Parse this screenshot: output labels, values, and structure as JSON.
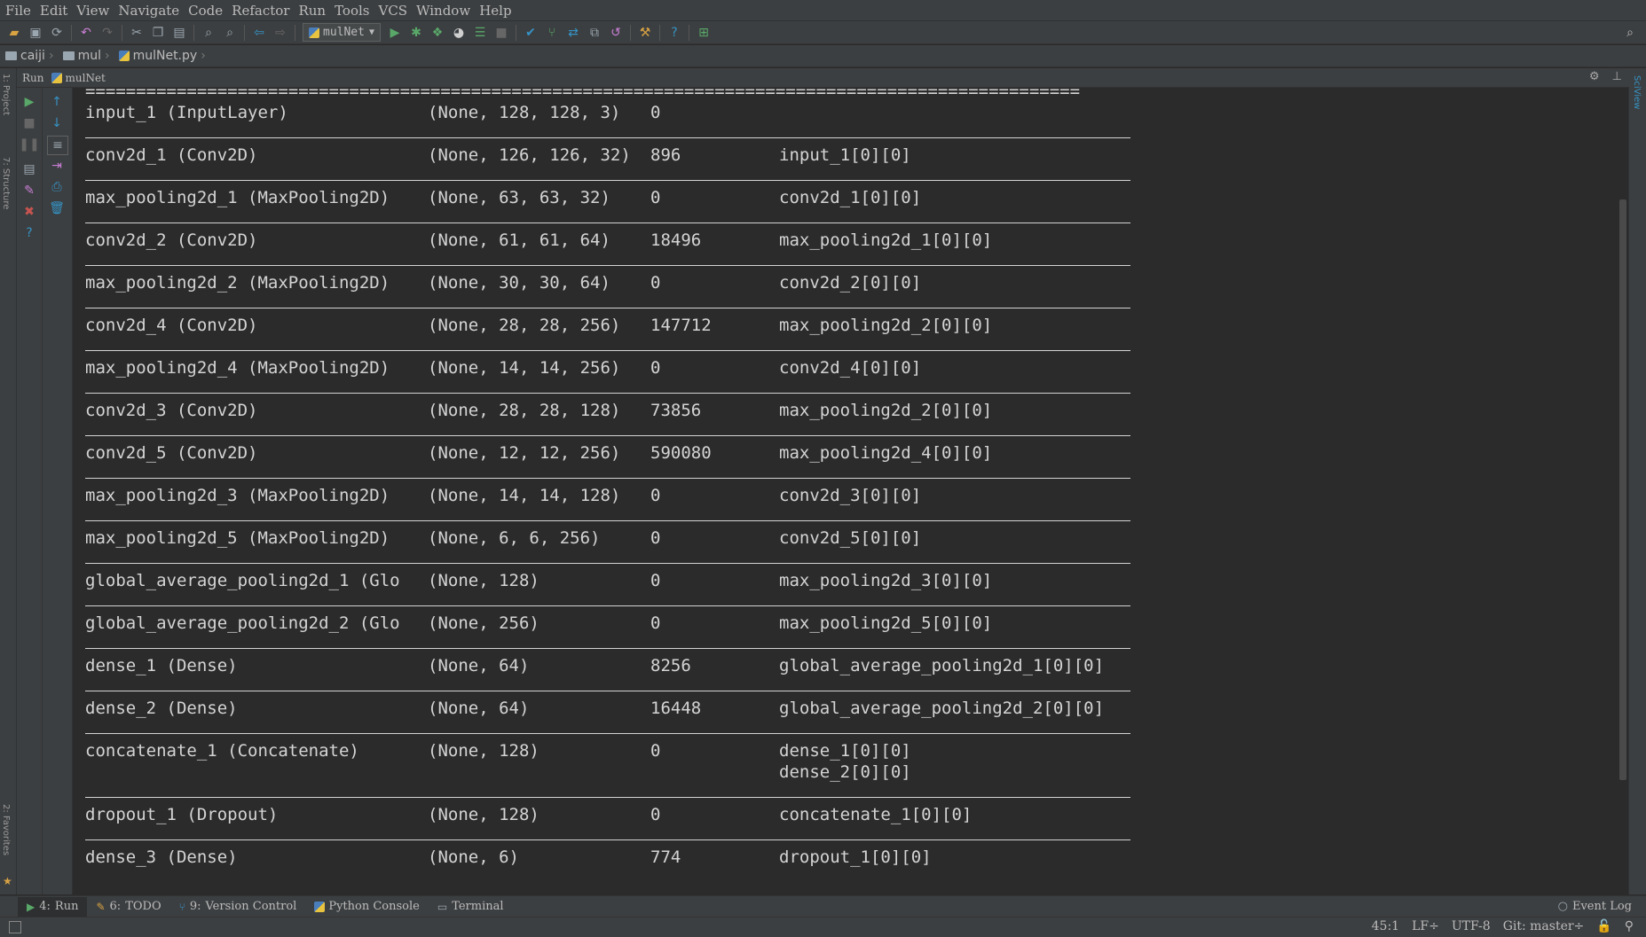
{
  "menu": [
    "File",
    "Edit",
    "View",
    "Navigate",
    "Code",
    "Refactor",
    "Run",
    "Tools",
    "VCS",
    "Window",
    "Help"
  ],
  "toolbar": {
    "run_config": "mulNet"
  },
  "breadcrumbs": [
    "caiji",
    "mul",
    "mulNet.py"
  ],
  "run_panel": {
    "label": "Run",
    "tab": "mulNet"
  },
  "console": {
    "separator": "==================================================================================================",
    "rows": [
      {
        "layer": "input_1 (InputLayer)",
        "shape": "(None, 128, 128, 3)",
        "params": "0",
        "connected": []
      },
      {
        "layer": "conv2d_1 (Conv2D)",
        "shape": "(None, 126, 126, 32)",
        "params": "896",
        "connected": [
          "input_1[0][0]"
        ]
      },
      {
        "layer": "max_pooling2d_1 (MaxPooling2D)",
        "shape": "(None, 63, 63, 32)",
        "params": "0",
        "connected": [
          "conv2d_1[0][0]"
        ]
      },
      {
        "layer": "conv2d_2 (Conv2D)",
        "shape": "(None, 61, 61, 64)",
        "params": "18496",
        "connected": [
          "max_pooling2d_1[0][0]"
        ]
      },
      {
        "layer": "max_pooling2d_2 (MaxPooling2D)",
        "shape": "(None, 30, 30, 64)",
        "params": "0",
        "connected": [
          "conv2d_2[0][0]"
        ]
      },
      {
        "layer": "conv2d_4 (Conv2D)",
        "shape": "(None, 28, 28, 256)",
        "params": "147712",
        "connected": [
          "max_pooling2d_2[0][0]"
        ]
      },
      {
        "layer": "max_pooling2d_4 (MaxPooling2D)",
        "shape": "(None, 14, 14, 256)",
        "params": "0",
        "connected": [
          "conv2d_4[0][0]"
        ]
      },
      {
        "layer": "conv2d_3 (Conv2D)",
        "shape": "(None, 28, 28, 128)",
        "params": "73856",
        "connected": [
          "max_pooling2d_2[0][0]"
        ]
      },
      {
        "layer": "conv2d_5 (Conv2D)",
        "shape": "(None, 12, 12, 256)",
        "params": "590080",
        "connected": [
          "max_pooling2d_4[0][0]"
        ]
      },
      {
        "layer": "max_pooling2d_3 (MaxPooling2D)",
        "shape": "(None, 14, 14, 128)",
        "params": "0",
        "connected": [
          "conv2d_3[0][0]"
        ]
      },
      {
        "layer": "max_pooling2d_5 (MaxPooling2D)",
        "shape": "(None, 6, 6, 256)",
        "params": "0",
        "connected": [
          "conv2d_5[0][0]"
        ]
      },
      {
        "layer": "global_average_pooling2d_1 (Glo",
        "shape": "(None, 128)",
        "params": "0",
        "connected": [
          "max_pooling2d_3[0][0]"
        ]
      },
      {
        "layer": "global_average_pooling2d_2 (Glo",
        "shape": "(None, 256)",
        "params": "0",
        "connected": [
          "max_pooling2d_5[0][0]"
        ]
      },
      {
        "layer": "dense_1 (Dense)",
        "shape": "(None, 64)",
        "params": "8256",
        "connected": [
          "global_average_pooling2d_1[0][0]"
        ]
      },
      {
        "layer": "dense_2 (Dense)",
        "shape": "(None, 64)",
        "params": "16448",
        "connected": [
          "global_average_pooling2d_2[0][0]"
        ]
      },
      {
        "layer": "concatenate_1 (Concatenate)",
        "shape": "(None, 128)",
        "params": "0",
        "connected": [
          "dense_1[0][0]",
          "dense_2[0][0]"
        ]
      },
      {
        "layer": "dropout_1 (Dropout)",
        "shape": "(None, 128)",
        "params": "0",
        "connected": [
          "concatenate_1[0][0]"
        ]
      },
      {
        "layer": "dense_3 (Dense)",
        "shape": "(None, 6)",
        "params": "774",
        "connected": [
          "dropout_1[0][0]"
        ]
      }
    ]
  },
  "bottom_tabs": [
    {
      "num": "4",
      "label": "Run",
      "active": true
    },
    {
      "num": "6",
      "label": "TODO"
    },
    {
      "num": "9",
      "label": "Version Control"
    },
    {
      "num": "",
      "label": "Python Console"
    },
    {
      "num": "",
      "label": "Terminal"
    }
  ],
  "event_log": "Event Log",
  "status": {
    "position": "45:1",
    "line_sep": "LF÷",
    "encoding": "UTF-8",
    "git": "Git: master÷"
  },
  "colors": {
    "background": "#2b2b2b",
    "panel": "#3c3f41",
    "text": "#bbbbbb",
    "console_text": "#d4d4d4",
    "run_green": "#59a869",
    "stop_red": "#c75450",
    "link_blue": "#3592c4"
  }
}
